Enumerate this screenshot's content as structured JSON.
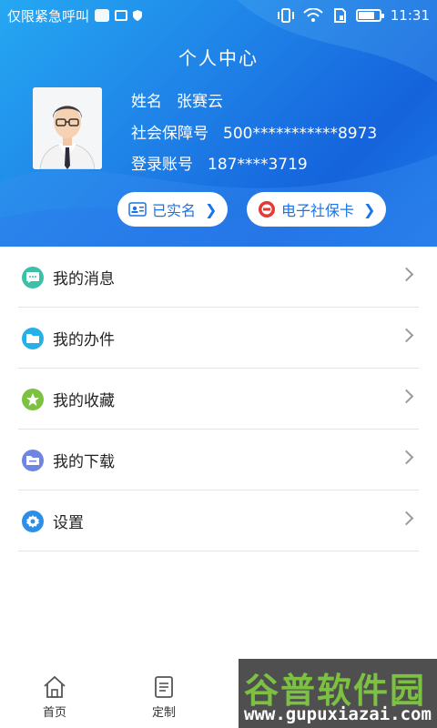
{
  "status_bar": {
    "carrier_text": "仅限紧急呼叫",
    "time": "11:31"
  },
  "header": {
    "title": "个人中心",
    "name_label": "姓名",
    "name_value": "张赛云",
    "ssn_label": "社会保障号",
    "ssn_value": "500***********8973",
    "account_label": "登录账号",
    "account_value": "187****3719"
  },
  "pills": {
    "verified": "已实名",
    "card": "电子社保卡"
  },
  "menu": [
    {
      "label": "我的消息",
      "icon": "message-icon",
      "color": "#3cc0a8"
    },
    {
      "label": "我的办件",
      "icon": "folder-icon",
      "color": "#26b0e6"
    },
    {
      "label": "我的收藏",
      "icon": "star-icon",
      "color": "#7cc142"
    },
    {
      "label": "我的下载",
      "icon": "download-folder-icon",
      "color": "#6e86e0"
    },
    {
      "label": "设置",
      "icon": "gear-icon",
      "color": "#2d8fe8"
    }
  ],
  "tabbar": [
    {
      "label": "首页",
      "icon": "home-icon"
    },
    {
      "label": "定制",
      "icon": "clipboard-icon"
    }
  ],
  "watermark": {
    "title": "谷普软件园",
    "url": "www.gupuxiazai.com"
  }
}
